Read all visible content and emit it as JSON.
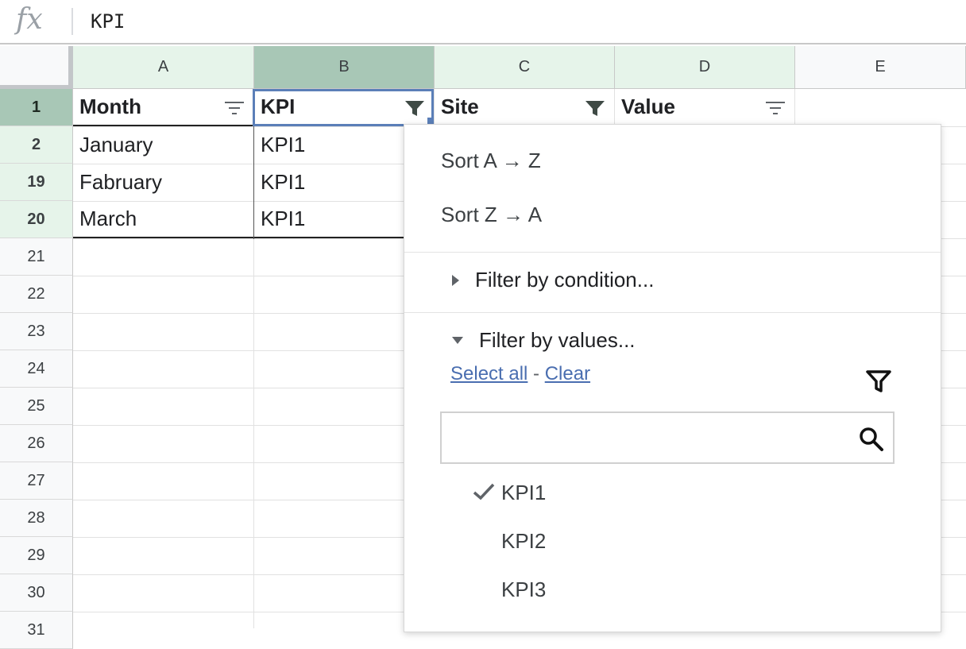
{
  "formula_bar": {
    "fx_label": "fx",
    "value": "KPI"
  },
  "columns": [
    "A",
    "B",
    "C",
    "D",
    "E"
  ],
  "rows": [
    "1",
    "2",
    "19",
    "20",
    "21",
    "22",
    "23",
    "24",
    "25",
    "26",
    "27",
    "28",
    "29",
    "30",
    "31"
  ],
  "header_row": {
    "a": "Month",
    "b": "KPI",
    "c": "Site",
    "d": "Value"
  },
  "data_rows": [
    {
      "a": "January",
      "b": "KPI1"
    },
    {
      "a": "Fabruary",
      "b": "KPI1"
    },
    {
      "a": "March",
      "b": "KPI1"
    }
  ],
  "filter_menu": {
    "sort_az": "Sort A → Z",
    "sort_za": "Sort Z → A",
    "filter_by_condition": "Filter by condition...",
    "filter_by_values": "Filter by values...",
    "select_all": "Select all",
    "link_separator": " - ",
    "clear": "Clear",
    "search_placeholder": "",
    "values": [
      {
        "label": "KPI1",
        "checked": true
      },
      {
        "label": "KPI2",
        "checked": false
      },
      {
        "label": "KPI3",
        "checked": false
      }
    ]
  },
  "colors": {
    "selected_header": "#e6f4ea",
    "active_header": "#a8c7b6",
    "selection_border": "#5b7fb8",
    "link": "#4a6eb0"
  }
}
